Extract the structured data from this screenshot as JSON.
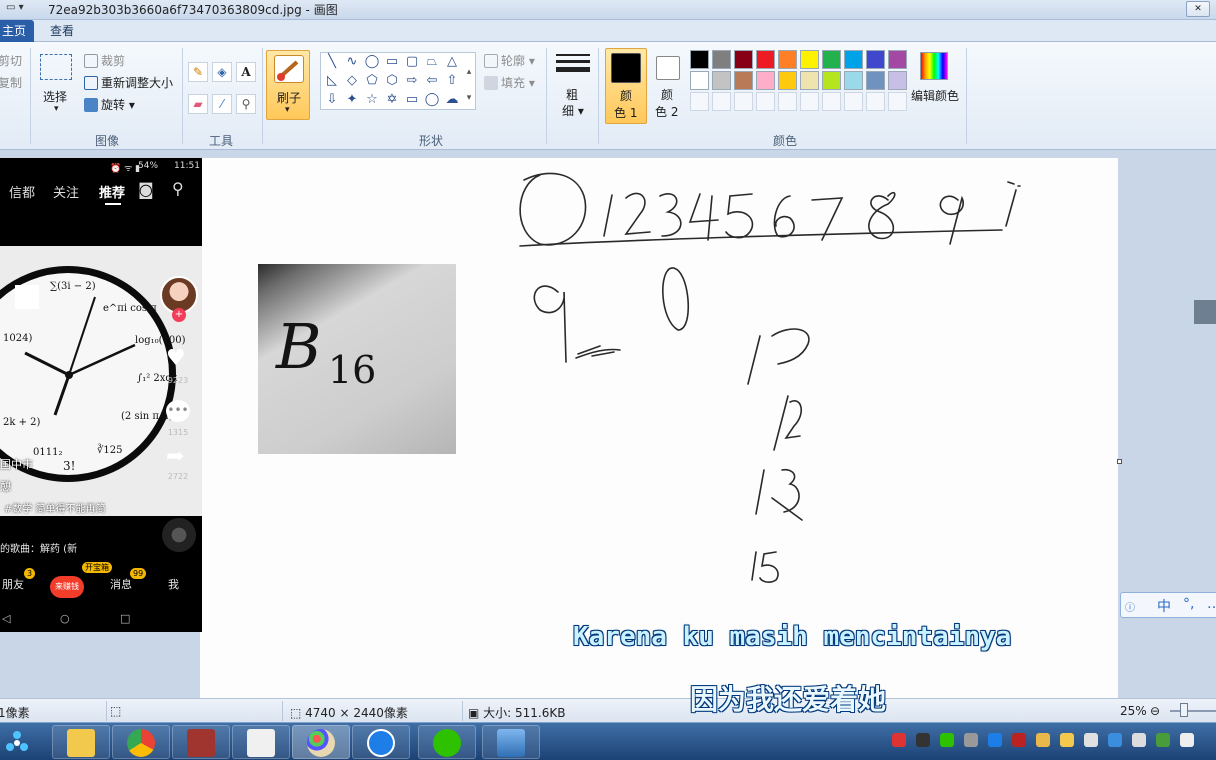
{
  "window": {
    "title": "72ea92b303b3660a6f73470363809cd.jpg - 画图",
    "close_glyph": "✕"
  },
  "ribbon": {
    "tabs": [
      "主页",
      "查看"
    ],
    "clipboard": {
      "cut": "剪切",
      "copy": "复制"
    },
    "image": {
      "select": "选择",
      "crop": "裁剪",
      "resize": "重新调整大小",
      "rotate": "旋转",
      "group": "图像"
    },
    "tools": {
      "text_tool": "A",
      "group": "工具"
    },
    "brush": {
      "label": "刷子"
    },
    "shapes": {
      "outline": "轮廓",
      "fill": "填充",
      "group": "形状"
    },
    "size": {
      "label_line1": "粗",
      "label_line2": "细"
    },
    "colors": {
      "color1_line1": "颜",
      "color1_line2": "色 1",
      "color2_line1": "颜",
      "color2_line2": "色 2",
      "edit": "编辑颜色",
      "group": "颜色",
      "color1_value": "#000000",
      "color2_value": "#ffffff",
      "palette": [
        "#000000",
        "#7f7f7f",
        "#880015",
        "#ed1c24",
        "#ff7f27",
        "#fff200",
        "#22b14c",
        "#00a2e8",
        "#3f48cc",
        "#a349a4",
        "#ffffff",
        "#c3c3c3",
        "#b97a57",
        "#ffaec9",
        "#ffc90e",
        "#efe4b0",
        "#b5e61d",
        "#99d9ea",
        "#7092be",
        "#c8bfe7"
      ]
    }
  },
  "phone": {
    "status": "54%",
    "time": "11:51",
    "nav": [
      "信都",
      "关注",
      "推荐"
    ],
    "likes": "9223",
    "comments": "1315",
    "shares": "2722",
    "clock_formulas": [
      "∑(3i − 2)",
      "e^πi cos π",
      "log₁₀(100)",
      "1024)",
      "∫₁² 2xdx",
      "2k + 2)",
      "(2 sin π/2)²",
      "0111₂",
      "∛125",
      "3!"
    ],
    "tag": "#数学 简单得不能再简",
    "song": "的歌曲：解药 (新",
    "tabs": [
      "朋友",
      "来赚钱",
      "消息",
      "我"
    ],
    "badges": {
      "friends": "3",
      "treasure": "开宝箱",
      "messages": "99"
    },
    "side_text": [
      "国中市",
      "憩"
    ]
  },
  "canvas_image": {
    "letter": "B",
    "subscript": "16"
  },
  "subtitles": {
    "id": "Karena ku masih mencintainya",
    "zh": "因为我还爱着她"
  },
  "ime": {
    "lang": "中"
  },
  "statusbar": {
    "pixel_label": "1像素",
    "dimensions": "4740 × 2440像素",
    "size": "大小: 511.6KB",
    "zoom": "25%"
  }
}
